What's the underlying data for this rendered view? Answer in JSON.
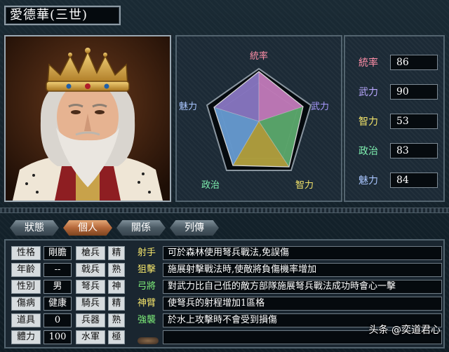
{
  "title": "愛德華(三世)",
  "radar": {
    "labels": [
      {
        "text": "統率",
        "color": "#ff8fa8"
      },
      {
        "text": "武力",
        "color": "#a99aff"
      },
      {
        "text": "智力",
        "color": "#f2e36a"
      },
      {
        "text": "政治",
        "color": "#7ff0b0"
      },
      {
        "text": "魅力",
        "color": "#a9c6ff"
      }
    ]
  },
  "stats": [
    {
      "label": "統率",
      "value": "86",
      "color": "#ff8fa8"
    },
    {
      "label": "武力",
      "value": "90",
      "color": "#b9a8ff"
    },
    {
      "label": "智力",
      "value": "53",
      "color": "#f2e36a"
    },
    {
      "label": "政治",
      "value": "83",
      "color": "#7ff0b0"
    },
    {
      "label": "魅力",
      "value": "84",
      "color": "#a9c6ff"
    }
  ],
  "tabs": [
    "狀態",
    "個人",
    "關係",
    "列傳"
  ],
  "personal": [
    {
      "label": "性格",
      "value": "剛膽"
    },
    {
      "label": "年齡",
      "value": "--"
    },
    {
      "label": "性別",
      "value": "男"
    },
    {
      "label": "傷病",
      "value": "健康"
    },
    {
      "label": "道具",
      "value": "0"
    },
    {
      "label": "體力",
      "value": "100"
    }
  ],
  "aptitude": [
    {
      "label": "槍兵",
      "value": "精"
    },
    {
      "label": "戟兵",
      "value": "熟"
    },
    {
      "label": "弩兵",
      "value": "神"
    },
    {
      "label": "騎兵",
      "value": "精"
    },
    {
      "label": "兵器",
      "value": "熟"
    },
    {
      "label": "水軍",
      "value": "極"
    }
  ],
  "skills": [
    {
      "name": "射手",
      "color": "#f2e36a",
      "desc": "可於森林使用弩兵戰法,免誤傷"
    },
    {
      "name": "狙擊",
      "color": "#f2e36a",
      "desc": "施展射擊戰法時,使敵將負傷機率增加"
    },
    {
      "name": "弓將",
      "color": "#7ff07a",
      "desc": "對武力比自己低的敵方部隊施展弩兵戰法成功時會心一擊"
    },
    {
      "name": "神臂",
      "color": "#f2e36a",
      "desc": "使弩兵的射程增加1區格"
    },
    {
      "name": "強襲",
      "color": "#7ff07a",
      "desc": "於水上攻擊時不會受到損傷"
    }
  ],
  "watermark": "头条 @奕道君心"
}
